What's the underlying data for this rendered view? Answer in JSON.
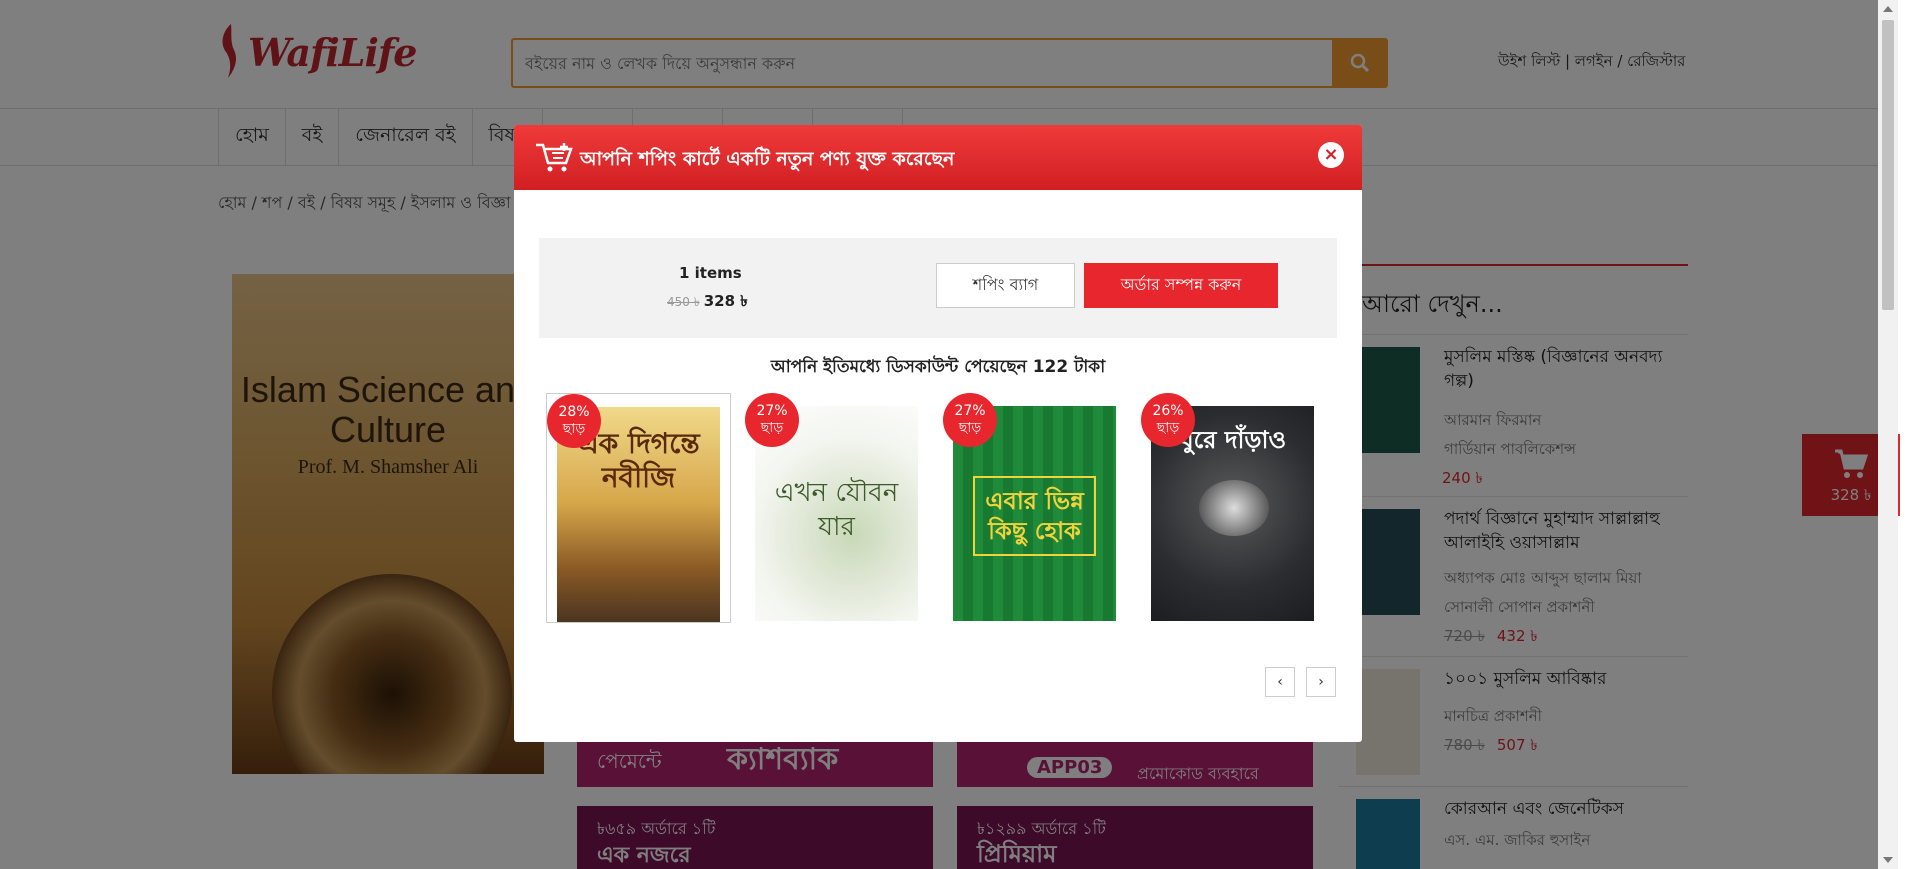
{
  "header": {
    "logo_text": "WafiLife",
    "search_placeholder": "বইয়ের নাম ও লেখক দিয়ে অনুসন্ধান করুন",
    "top_links": "উইশ লিস্ট | লগইন / রেজিস্টার"
  },
  "nav": {
    "items": [
      "হোম",
      "বই",
      "জেনারেল বই",
      "বিষয়"
    ]
  },
  "breadcrumb": "হোম / শপ / বই / বিষয় সমূহ / ইসলাম ও বিজ্ঞা",
  "book": {
    "title": "Islam Science and Culture",
    "author": "Prof. M. Shamsher Ali"
  },
  "promos": {
    "p1_text": "পেমেন্টে",
    "p1_big": "ক্যাশব্যাক",
    "p2_code": "APP03",
    "p2_text": "প্রমোকোড ব্যবহারে",
    "p3_text": "৳৬৫৯ অর্ডারে ১টি",
    "p3_text2": "এক নজরে",
    "p4_text": "৳১২৯৯ অর্ডারে ১টি",
    "p4_text2": "প্রিমিয়াম"
  },
  "side": {
    "title": "আরো দেখুন...",
    "items": [
      {
        "name": "মুসলিম মস্তিষ্ক (বিজ্ঞানের অনবদ্য গল্প)",
        "author": "আরমান ফিরমান",
        "publisher": "গার্ডিয়ান পাবলিকেশন্স",
        "old_price": "",
        "price": "240 ৳"
      },
      {
        "name": "পদার্থ বিজ্ঞানে মুহাম্মাদ সাল্লাল্লাহু আলাইহি ওয়াসাল্লাম",
        "author": "অধ্যাপক মোঃ আব্দুস ছালাম মিয়া",
        "publisher": "সোনালী সোপান প্রকাশনী",
        "old_price": "720 ৳",
        "price": "432 ৳"
      },
      {
        "name": "১০০১ মুসলিম আবিষ্কার",
        "author": "মানচিত্র প্রকাশনী",
        "publisher": "",
        "old_price": "780 ৳",
        "price": "507 ৳"
      },
      {
        "name": "কোরআন এবং জেনেটিকস",
        "author": "এস. এম. জাকির হুসাইন",
        "publisher": "",
        "old_price": "",
        "price": ""
      }
    ]
  },
  "float_cart": {
    "total": "328 ৳"
  },
  "modal": {
    "title": "আপনি শপিং কার্টে একটি নতুন পণ্য যুক্ত করেছেন",
    "close": "×",
    "items_count": "1 items",
    "old_price": "450 ৳",
    "price": "328 ৳",
    "bag_button": "শপিং ব্যাগ",
    "order_button": "অর্ডার সম্পন্ন করুন",
    "discount_msg": "আপনি ইতিমধ্যে ডিসকাউন্ট পেয়েছেন 122 টাকা",
    "cards": [
      {
        "discount": "28%",
        "off": "ছাড়",
        "cover_text": "এক দিগন্তে নবীজি"
      },
      {
        "discount": "27%",
        "off": "ছাড়",
        "cover_text": "এখন যৌবন যার"
      },
      {
        "discount": "27%",
        "off": "ছাড়",
        "cover_text": "এবার ভিন্ন কিছু হোক"
      },
      {
        "discount": "26%",
        "off": "ছাড়",
        "cover_text": "ঘুরে দাঁড়াও"
      }
    ],
    "prev": "‹",
    "next": "›"
  },
  "colors": {
    "brand_red": "#e8262d",
    "search_orange": "#f29a2e",
    "overlay": "rgba(0,0,0,0.5)"
  }
}
